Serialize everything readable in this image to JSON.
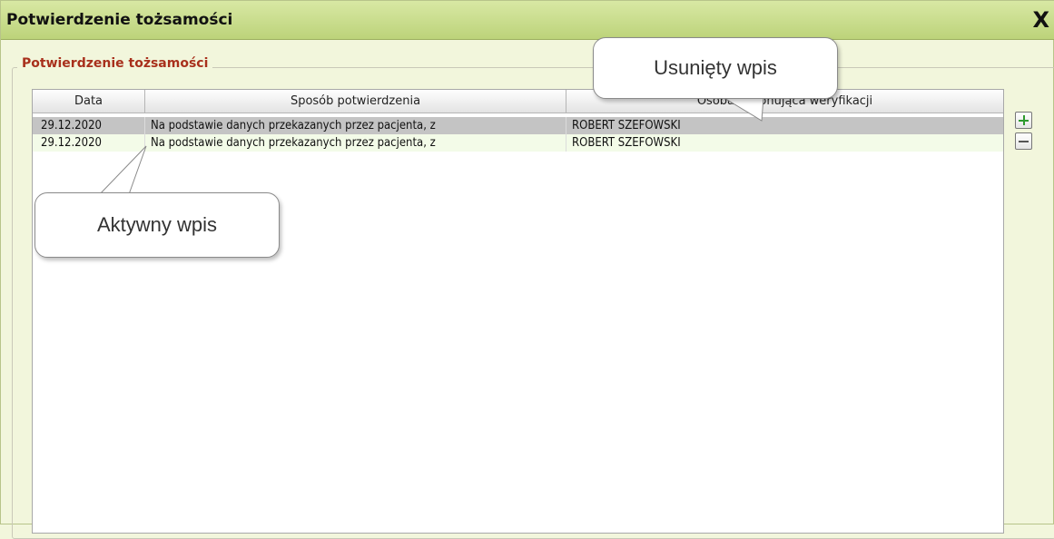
{
  "window": {
    "title": "Potwierdzenie tożsamości",
    "close_label": "X"
  },
  "section": {
    "legend": "Potwierdzenie tożsamości"
  },
  "table": {
    "columns": [
      "Data",
      "Sposób potwierdzenia",
      "Osoba dokonująca weryfikacji"
    ],
    "rows": [
      {
        "date": "29.12.2020",
        "method": "Na podstawie danych przekazanych przez pacjenta, z",
        "person": "ROBERT SZEFOWSKI",
        "state": "deleted"
      },
      {
        "date": "29.12.2020",
        "method": "Na podstawie danych przekazanych przez pacjenta, z",
        "person": "ROBERT SZEFOWSKI",
        "state": "active"
      }
    ]
  },
  "buttons": {
    "add_icon": "plus-icon",
    "remove_icon": "minus-icon"
  },
  "callouts": {
    "deleted": "Usunięty wpis",
    "active": "Aktywny wpis"
  },
  "colors": {
    "titlebar": "#bcd37a",
    "legend": "#a8301c",
    "deleted_row": "#c4c4c4",
    "active_row": "#f3fbe8"
  }
}
